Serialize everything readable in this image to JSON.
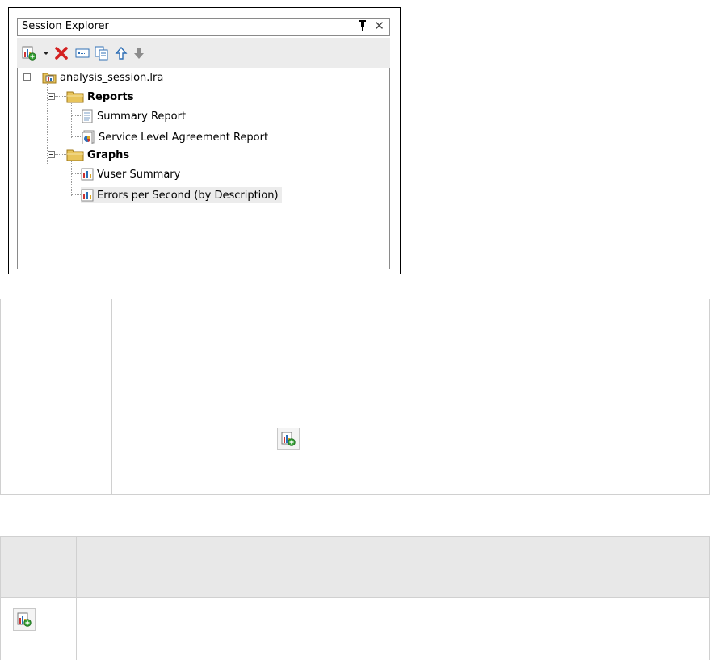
{
  "panel": {
    "title": "Session Explorer",
    "close_glyph": "✕",
    "toolbar": [
      {
        "name": "add-report-graph-icon"
      },
      {
        "name": "dropdown-arrow-icon"
      },
      {
        "name": "delete-icon"
      },
      {
        "name": "rename-icon"
      },
      {
        "name": "duplicate-icon"
      },
      {
        "name": "move-up-icon"
      },
      {
        "name": "move-down-icon"
      }
    ]
  },
  "tree": {
    "root": "analysis_session.lra",
    "groups": [
      {
        "label": "Reports",
        "items": [
          "Summary Report",
          "Service Level Agreement Report"
        ]
      },
      {
        "label": "Graphs",
        "items": [
          "Vuser Summary",
          "Errors per Second (by Description)"
        ]
      }
    ]
  },
  "colors": {
    "selection": "#ececec",
    "folder": "#e8c45a",
    "delete": "#d42020",
    "arrow_up": "#2f6fb5",
    "arrow_down": "#8c8c8c"
  }
}
